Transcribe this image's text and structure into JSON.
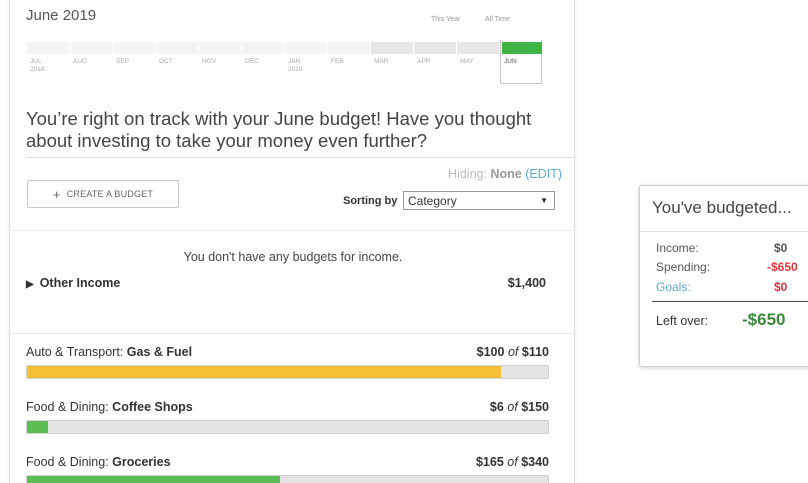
{
  "month_title": "June 2019",
  "range_options": {
    "this_year": "This Year",
    "all_time": "All Time"
  },
  "timeline": [
    {
      "label": "JUL",
      "sub": "2018",
      "has_bar": false,
      "current": false
    },
    {
      "label": "AUG",
      "sub": "",
      "has_bar": false,
      "current": false
    },
    {
      "label": "SEP",
      "sub": "",
      "has_bar": false,
      "current": false
    },
    {
      "label": "OCT",
      "sub": "",
      "has_bar": false,
      "current": false
    },
    {
      "label": "NOV",
      "sub": "",
      "has_bar": false,
      "current": false
    },
    {
      "label": "DEC",
      "sub": "",
      "has_bar": false,
      "current": false
    },
    {
      "label": "JAN",
      "sub": "2019",
      "has_bar": false,
      "current": false
    },
    {
      "label": "FEB",
      "sub": "",
      "has_bar": false,
      "current": false
    },
    {
      "label": "MAR",
      "sub": "",
      "has_bar": true,
      "current": false
    },
    {
      "label": "APR",
      "sub": "",
      "has_bar": true,
      "current": false
    },
    {
      "label": "MAY",
      "sub": "",
      "has_bar": true,
      "current": false
    },
    {
      "label": "JUN",
      "sub": "",
      "has_bar": true,
      "current": true
    }
  ],
  "headline": "You’re right on track with your June budget! Have you thought about investing to take your money even further?",
  "hiding": {
    "label": "Hiding:",
    "value": "None",
    "edit": "(EDIT)"
  },
  "create_button": "CREATE A BUDGET",
  "sorting": {
    "label": "Sorting by",
    "selected": "Category"
  },
  "income": {
    "no_budgets_text": "You don't have any budgets for income.",
    "other_label": "Other Income",
    "other_amount": "$1,400"
  },
  "budgets": [
    {
      "category": "Auto & Transport:",
      "name": "Gas & Fuel",
      "spent": "$100",
      "of": "of",
      "total": "$110",
      "progress": 0.909,
      "color": "#f5c137"
    },
    {
      "category": "Food & Dining:",
      "name": "Coffee Shops",
      "spent": "$6",
      "of": "of",
      "total": "$150",
      "progress": 0.04,
      "color": "#5cbd55"
    },
    {
      "category": "Food & Dining:",
      "name": "Groceries",
      "spent": "$165",
      "of": "of",
      "total": "$340",
      "progress": 0.485,
      "color": "#5cbd55"
    }
  ],
  "summary": {
    "title": "You've budgeted...",
    "income_label": "Income:",
    "income_value": "$0",
    "spending_label": "Spending:",
    "spending_value": "-$650",
    "goals_label": "Goals:",
    "goals_value": "$0",
    "left_label": "Left over:",
    "left_value": "-$650",
    "colors": {
      "negative": "#e0363c",
      "positive_total": "#3a8a3a",
      "goals_link": "#5aa9d6"
    }
  }
}
